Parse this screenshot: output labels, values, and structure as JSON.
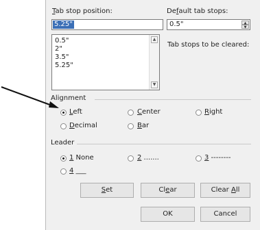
{
  "tab_stop": {
    "label": "Tab stop position:",
    "value": "5.25\"",
    "list": [
      "0.5\"",
      "2\"",
      "3.5\"",
      "5.25\""
    ]
  },
  "default_tabs": {
    "label": "Default tab stops:",
    "value": "0.5\""
  },
  "cleared_label": "Tab stops to be cleared:",
  "alignment": {
    "title": "Alignment",
    "options": [
      "Left",
      "Center",
      "Right",
      "Decimal",
      "Bar"
    ],
    "selected": "Left"
  },
  "leader": {
    "title": "Leader",
    "options": [
      "1 None",
      "2 .......",
      "3 --------",
      "4 ___"
    ],
    "selected": "1 None"
  },
  "buttons": {
    "set": "Set",
    "clear": "Clear",
    "clear_all": "Clear All",
    "ok": "OK",
    "cancel": "Cancel"
  }
}
